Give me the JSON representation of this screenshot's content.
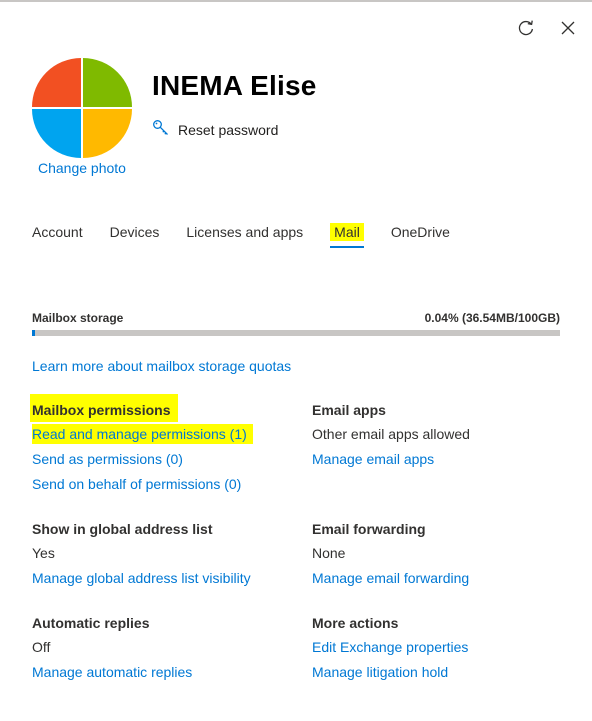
{
  "header": {
    "user_name": "INEMA Elise",
    "change_photo": "Change photo",
    "reset_password": "Reset password"
  },
  "tabs": [
    {
      "label": "Account",
      "active": false
    },
    {
      "label": "Devices",
      "active": false
    },
    {
      "label": "Licenses and apps",
      "active": false
    },
    {
      "label": "Mail",
      "active": true
    },
    {
      "label": "OneDrive",
      "active": false
    }
  ],
  "storage": {
    "label": "Mailbox storage",
    "value": "0.04% (36.54MB/100GB)",
    "used_percent": 0.04,
    "learn_more": "Learn more about mailbox storage quotas"
  },
  "sections": {
    "mailbox_permissions": {
      "heading": "Mailbox permissions",
      "read_manage": "Read and manage permissions (1)",
      "send_as": "Send as permissions (0)",
      "send_on_behalf": "Send on behalf of permissions (0)"
    },
    "email_apps": {
      "heading": "Email apps",
      "status": "Other email apps allowed",
      "manage": "Manage email apps"
    },
    "global_address": {
      "heading": "Show in global address list",
      "status": "Yes",
      "manage": "Manage global address list visibility"
    },
    "email_forwarding": {
      "heading": "Email forwarding",
      "status": "None",
      "manage": "Manage email forwarding"
    },
    "automatic_replies": {
      "heading": "Automatic replies",
      "status": "Off",
      "manage": "Manage automatic replies"
    },
    "more_actions": {
      "heading": "More actions",
      "edit_exchange": "Edit Exchange properties",
      "litigation_hold": "Manage litigation hold"
    }
  },
  "colors": {
    "accent": "#0078d4",
    "highlight": "#ffff00",
    "avatar_red": "#f25022",
    "avatar_green": "#7fba00",
    "avatar_blue": "#00a4ef",
    "avatar_yellow": "#ffb900"
  },
  "icons": {
    "refresh": "refresh-icon",
    "close": "close-icon",
    "reset_password": "key-icon"
  }
}
